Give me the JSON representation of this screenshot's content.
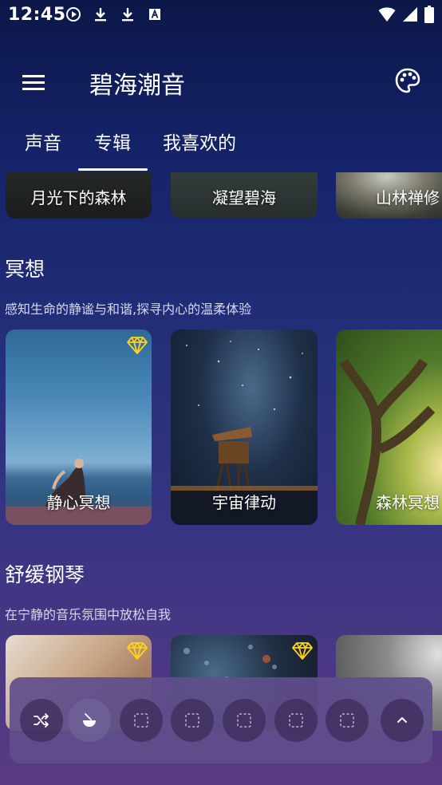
{
  "status_bar": {
    "time": "12:45",
    "left_icons": [
      "play-circle-icon",
      "download-icon",
      "download-icon",
      "keyboard-a-icon"
    ],
    "right_icons": [
      "wifi-icon",
      "signal-icon",
      "battery-icon"
    ]
  },
  "app_bar": {
    "title": "碧海潮音",
    "menu_icon": "menu-icon",
    "palette_icon": "palette-icon"
  },
  "tabs": [
    {
      "label": "声音",
      "selected": false
    },
    {
      "label": "专辑",
      "selected": true
    },
    {
      "label": "我喜欢的",
      "selected": false
    }
  ],
  "top_row": [
    {
      "label": "月光下的森林"
    },
    {
      "label": "凝望碧海"
    },
    {
      "label": "山林禅修"
    }
  ],
  "sections": [
    {
      "title": "冥想",
      "subtitle": "感知生命的静谧与和谐,探寻内心的温柔体验",
      "albums": [
        {
          "label": "静心冥想",
          "premium": true
        },
        {
          "label": "宇宙律动",
          "premium": false
        },
        {
          "label": "森林冥想",
          "premium": false
        }
      ]
    },
    {
      "title": "舒缓钢琴",
      "subtitle": "在宁静的音乐氛围中放松自我",
      "albums": [
        {
          "label": "",
          "premium": true
        },
        {
          "label": "",
          "premium": true
        },
        {
          "label": "",
          "premium": false
        }
      ]
    }
  ],
  "player": {
    "controls": [
      "shuffle-icon",
      "bowl-icon",
      "empty-slot-icon",
      "empty-slot-icon",
      "empty-slot-icon",
      "empty-slot-icon",
      "empty-slot-icon",
      "chevron-up-icon"
    ]
  },
  "colors": {
    "background_top": "#0c1748",
    "background_bottom": "#5a3b82",
    "premium_gem": "#ffd21a",
    "player_bg": "#5f4e8c"
  }
}
